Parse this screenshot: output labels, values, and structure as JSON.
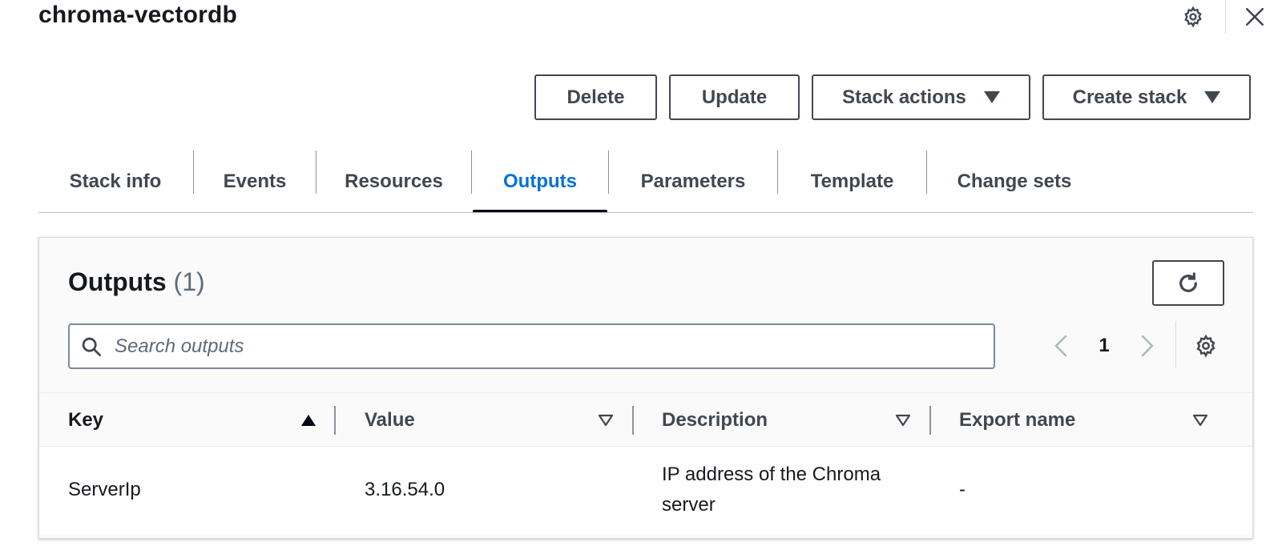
{
  "window": {
    "title": "chroma-vectordb"
  },
  "toolbar": {
    "delete_label": "Delete",
    "update_label": "Update",
    "stack_actions_label": "Stack actions",
    "create_stack_label": "Create stack"
  },
  "tabs": [
    {
      "label": "Stack info"
    },
    {
      "label": "Events"
    },
    {
      "label": "Resources"
    },
    {
      "label": "Outputs",
      "active": true
    },
    {
      "label": "Parameters"
    },
    {
      "label": "Template"
    },
    {
      "label": "Change sets"
    }
  ],
  "outputs": {
    "title": "Outputs",
    "count": "(1)",
    "search_placeholder": "Search outputs",
    "page": "1",
    "columns": [
      "Key",
      "Value",
      "Description",
      "Export name"
    ],
    "rows": [
      {
        "key": "ServerIp",
        "value": "3.16.54.0",
        "description": "IP address of the Chroma server",
        "export_name": "-"
      }
    ]
  },
  "colors": {
    "accent": "#0972d3",
    "text": "#16191f",
    "button_border": "#414750"
  },
  "icons": [
    "settings-gear-icon",
    "close-icon",
    "caret-down-icon",
    "refresh-icon",
    "search-icon",
    "chevron-left-icon",
    "chevron-right-icon",
    "sort-ascending-icon",
    "sort-descending-icon"
  ]
}
